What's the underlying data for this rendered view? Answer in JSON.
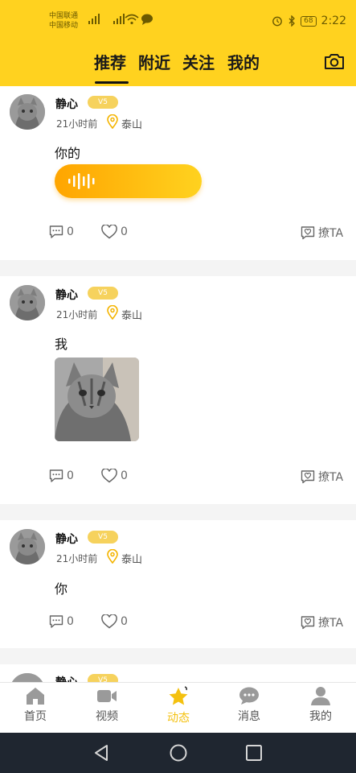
{
  "status_bar": {
    "carrier1": "中国联通",
    "carrier2": "中国移动",
    "sig1": "4G",
    "sig2": "4G",
    "battery": "68",
    "time": "2:22"
  },
  "tabs": [
    {
      "label": "推荐"
    },
    {
      "label": "附近"
    },
    {
      "label": "关注"
    },
    {
      "label": "我的"
    }
  ],
  "active_tab": "推荐",
  "posts": [
    {
      "username": "静心",
      "badge": "V5",
      "time": "21小时前",
      "location": "泰山",
      "text": "你的",
      "media": "voice",
      "comments": "0",
      "likes": "0",
      "flirt": "撩TA"
    },
    {
      "username": "静心",
      "badge": "V5",
      "time": "21小时前",
      "location": "泰山",
      "text": "我",
      "media": "photo",
      "comments": "0",
      "likes": "0",
      "flirt": "撩TA"
    },
    {
      "username": "静心",
      "badge": "V5",
      "time": "21小时前",
      "location": "泰山",
      "text": "你",
      "media": "none",
      "comments": "0",
      "likes": "0",
      "flirt": "撩TA"
    },
    {
      "username": "静心",
      "badge": "V5"
    }
  ],
  "bottom_nav": [
    {
      "label": "首页",
      "icon": "home-icon"
    },
    {
      "label": "视频",
      "icon": "video-icon"
    },
    {
      "label": "动态",
      "icon": "star-icon"
    },
    {
      "label": "消息",
      "icon": "message-icon"
    },
    {
      "label": "我的",
      "icon": "person-icon"
    }
  ],
  "active_nav": "动态",
  "colors": {
    "brand_yellow": "#FFD21F",
    "badge_yellow": "#F6D25D",
    "voice_orange": "#FFA500",
    "active_nav": "#F4C10F",
    "sys_nav_bg": "#1f2630"
  }
}
